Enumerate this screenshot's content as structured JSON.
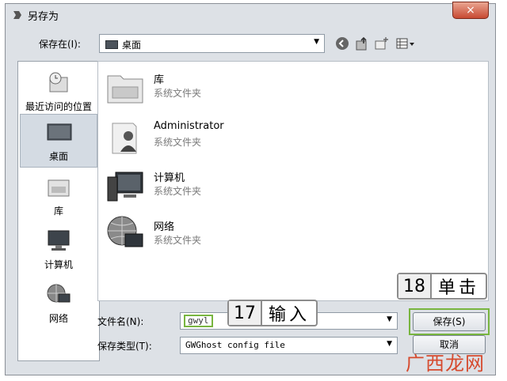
{
  "window": {
    "title": "另存为",
    "close_glyph": "×"
  },
  "toolbar": {
    "save_in_label": "保存在(I):",
    "location": "桌面",
    "icons": [
      "back-icon",
      "up-folder-icon",
      "new-folder-icon",
      "view-menu-icon"
    ]
  },
  "places": [
    {
      "label": "最近访问的位置",
      "icon": "recent-places-icon"
    },
    {
      "label": "桌面",
      "icon": "desktop-icon",
      "active": true
    },
    {
      "label": "库",
      "icon": "libraries-icon"
    },
    {
      "label": "计算机",
      "icon": "computer-icon"
    },
    {
      "label": "网络",
      "icon": "network-icon"
    }
  ],
  "files": [
    {
      "name": "库",
      "type": "系统文件夹",
      "icon": "libraries-icon"
    },
    {
      "name": "Administrator",
      "type": "系统文件夹",
      "icon": "user-folder-icon"
    },
    {
      "name": "计算机",
      "type": "系统文件夹",
      "icon": "computer-icon"
    },
    {
      "name": "网络",
      "type": "系统文件夹",
      "icon": "network-icon"
    }
  ],
  "form": {
    "filename_label": "文件名(N):",
    "filename_value": "gwyl",
    "filetype_label": "保存类型(T):",
    "filetype_value": "GWGhost config file"
  },
  "buttons": {
    "save": "保存(S)",
    "cancel": "取消"
  },
  "callouts": [
    {
      "num": "17",
      "text": "输入"
    },
    {
      "num": "18",
      "text": "单击"
    }
  ],
  "watermark": "广西龙网",
  "colors": {
    "highlight": "#78b53f",
    "watermark": "#d64a2e"
  }
}
